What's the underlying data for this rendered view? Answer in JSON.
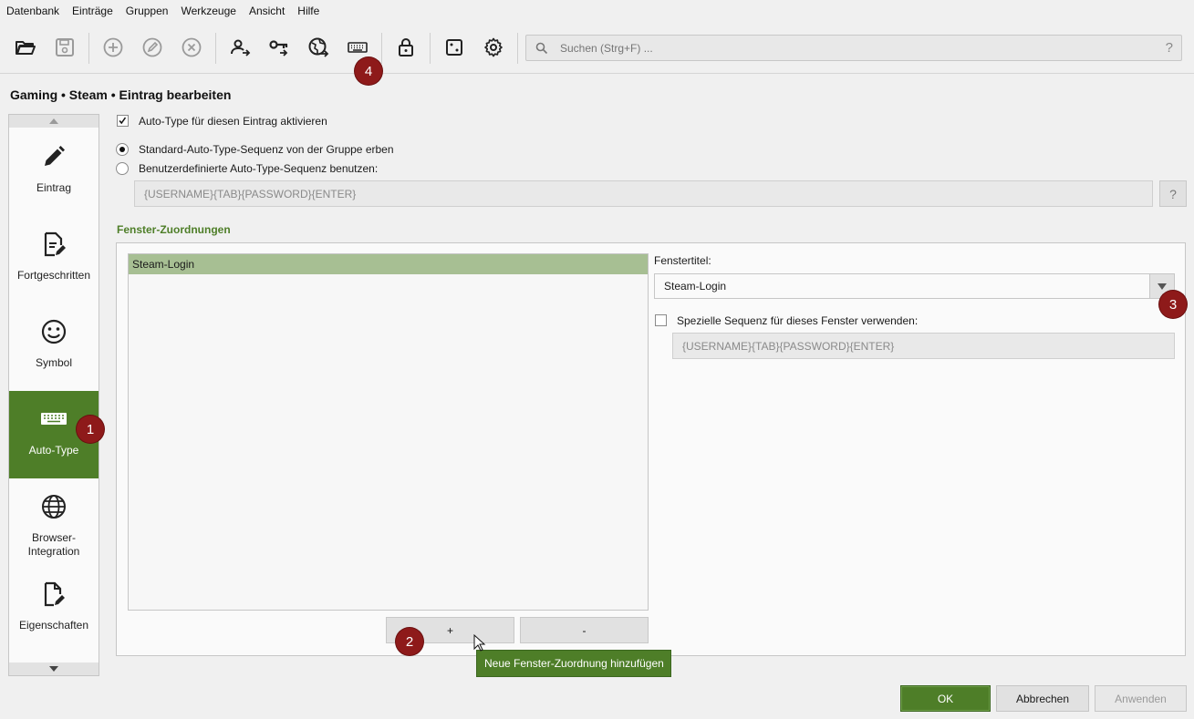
{
  "menu": [
    "Datenbank",
    "Einträge",
    "Gruppen",
    "Werkzeuge",
    "Ansicht",
    "Hilfe"
  ],
  "toolbar": {
    "icons": [
      "folder-open-icon",
      "save-icon",
      "add-entry-icon",
      "edit-entry-icon",
      "delete-entry-icon",
      "copy-username-icon",
      "copy-password-icon",
      "open-url-icon",
      "auto-type-icon",
      "lock-icon",
      "password-generator-icon",
      "settings-icon"
    ],
    "search_placeholder": "Suchen (Strg+F) ...",
    "search_help": "?"
  },
  "page_title": "Gaming • Steam • Eintrag bearbeiten",
  "sidebar": {
    "items": [
      {
        "label": "Eintrag",
        "icon": "pencil-icon"
      },
      {
        "label": "Fortgeschritten",
        "icon": "document-edit-icon"
      },
      {
        "label": "Symbol",
        "icon": "smiley-icon"
      },
      {
        "label": "Auto-Type",
        "icon": "keyboard-icon",
        "active": true
      },
      {
        "label": "Browser-\nIntegration",
        "icon": "globe-icon"
      },
      {
        "label": "Eigenschaften",
        "icon": "file-edit-icon"
      }
    ]
  },
  "autotype": {
    "enable_label": "Auto-Type für diesen Eintrag aktivieren",
    "enable_checked": true,
    "inherit_label": "Standard-Auto-Type-Sequenz von der Gruppe erben",
    "custom_label": "Benutzerdefinierte Auto-Type-Sequenz benutzen:",
    "selected_option": "inherit",
    "sequence_value": "{USERNAME}{TAB}{PASSWORD}{ENTER}",
    "sequence_help": "?"
  },
  "window_assoc": {
    "section_title": "Fenster-Zuordnungen",
    "list_items": [
      "Steam-Login"
    ],
    "add_label": "+",
    "remove_label": "-",
    "window_title_label": "Fenstertitel:",
    "window_title_value": "Steam-Login",
    "special_seq_label": "Spezielle Sequenz für dieses Fenster verwenden:",
    "special_seq_checked": false,
    "special_seq_value": "{USERNAME}{TAB}{PASSWORD}{ENTER}"
  },
  "tooltip": "Neue Fenster-Zuordnung hinzufügen",
  "badges": [
    "1",
    "2",
    "3",
    "4"
  ],
  "dialog": {
    "ok": "OK",
    "cancel": "Abbrechen",
    "apply": "Anwenden"
  },
  "colors": {
    "accent": "#4e7e28",
    "selection": "#a7bf93",
    "badge": "#8e1a1a"
  }
}
